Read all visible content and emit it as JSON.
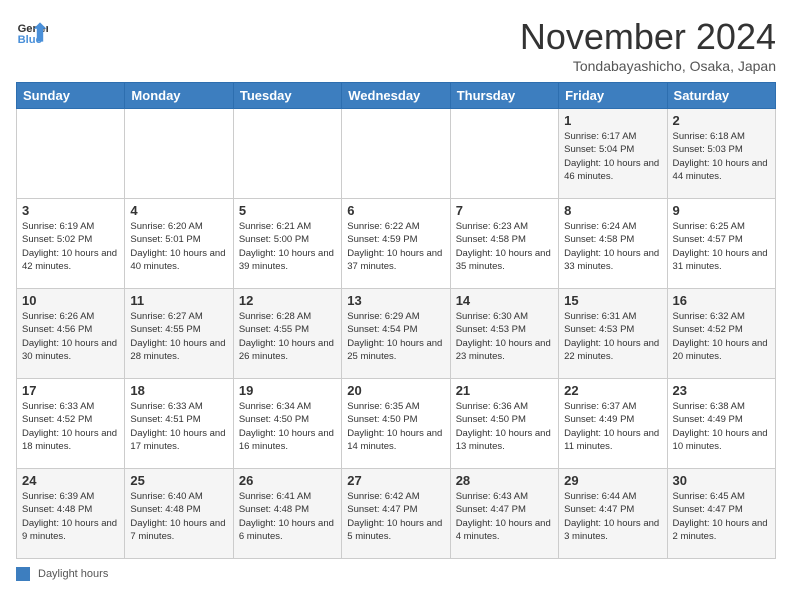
{
  "header": {
    "logo_line1": "General",
    "logo_line2": "Blue",
    "month": "November 2024",
    "location": "Tondabayashicho, Osaka, Japan"
  },
  "weekdays": [
    "Sunday",
    "Monday",
    "Tuesday",
    "Wednesday",
    "Thursday",
    "Friday",
    "Saturday"
  ],
  "legend": {
    "label": "Daylight hours"
  },
  "weeks": [
    [
      {
        "day": "",
        "info": ""
      },
      {
        "day": "",
        "info": ""
      },
      {
        "day": "",
        "info": ""
      },
      {
        "day": "",
        "info": ""
      },
      {
        "day": "",
        "info": ""
      },
      {
        "day": "1",
        "info": "Sunrise: 6:17 AM\nSunset: 5:04 PM\nDaylight: 10 hours and 46 minutes."
      },
      {
        "day": "2",
        "info": "Sunrise: 6:18 AM\nSunset: 5:03 PM\nDaylight: 10 hours and 44 minutes."
      }
    ],
    [
      {
        "day": "3",
        "info": "Sunrise: 6:19 AM\nSunset: 5:02 PM\nDaylight: 10 hours and 42 minutes."
      },
      {
        "day": "4",
        "info": "Sunrise: 6:20 AM\nSunset: 5:01 PM\nDaylight: 10 hours and 40 minutes."
      },
      {
        "day": "5",
        "info": "Sunrise: 6:21 AM\nSunset: 5:00 PM\nDaylight: 10 hours and 39 minutes."
      },
      {
        "day": "6",
        "info": "Sunrise: 6:22 AM\nSunset: 4:59 PM\nDaylight: 10 hours and 37 minutes."
      },
      {
        "day": "7",
        "info": "Sunrise: 6:23 AM\nSunset: 4:58 PM\nDaylight: 10 hours and 35 minutes."
      },
      {
        "day": "8",
        "info": "Sunrise: 6:24 AM\nSunset: 4:58 PM\nDaylight: 10 hours and 33 minutes."
      },
      {
        "day": "9",
        "info": "Sunrise: 6:25 AM\nSunset: 4:57 PM\nDaylight: 10 hours and 31 minutes."
      }
    ],
    [
      {
        "day": "10",
        "info": "Sunrise: 6:26 AM\nSunset: 4:56 PM\nDaylight: 10 hours and 30 minutes."
      },
      {
        "day": "11",
        "info": "Sunrise: 6:27 AM\nSunset: 4:55 PM\nDaylight: 10 hours and 28 minutes."
      },
      {
        "day": "12",
        "info": "Sunrise: 6:28 AM\nSunset: 4:55 PM\nDaylight: 10 hours and 26 minutes."
      },
      {
        "day": "13",
        "info": "Sunrise: 6:29 AM\nSunset: 4:54 PM\nDaylight: 10 hours and 25 minutes."
      },
      {
        "day": "14",
        "info": "Sunrise: 6:30 AM\nSunset: 4:53 PM\nDaylight: 10 hours and 23 minutes."
      },
      {
        "day": "15",
        "info": "Sunrise: 6:31 AM\nSunset: 4:53 PM\nDaylight: 10 hours and 22 minutes."
      },
      {
        "day": "16",
        "info": "Sunrise: 6:32 AM\nSunset: 4:52 PM\nDaylight: 10 hours and 20 minutes."
      }
    ],
    [
      {
        "day": "17",
        "info": "Sunrise: 6:33 AM\nSunset: 4:52 PM\nDaylight: 10 hours and 18 minutes."
      },
      {
        "day": "18",
        "info": "Sunrise: 6:33 AM\nSunset: 4:51 PM\nDaylight: 10 hours and 17 minutes."
      },
      {
        "day": "19",
        "info": "Sunrise: 6:34 AM\nSunset: 4:50 PM\nDaylight: 10 hours and 16 minutes."
      },
      {
        "day": "20",
        "info": "Sunrise: 6:35 AM\nSunset: 4:50 PM\nDaylight: 10 hours and 14 minutes."
      },
      {
        "day": "21",
        "info": "Sunrise: 6:36 AM\nSunset: 4:50 PM\nDaylight: 10 hours and 13 minutes."
      },
      {
        "day": "22",
        "info": "Sunrise: 6:37 AM\nSunset: 4:49 PM\nDaylight: 10 hours and 11 minutes."
      },
      {
        "day": "23",
        "info": "Sunrise: 6:38 AM\nSunset: 4:49 PM\nDaylight: 10 hours and 10 minutes."
      }
    ],
    [
      {
        "day": "24",
        "info": "Sunrise: 6:39 AM\nSunset: 4:48 PM\nDaylight: 10 hours and 9 minutes."
      },
      {
        "day": "25",
        "info": "Sunrise: 6:40 AM\nSunset: 4:48 PM\nDaylight: 10 hours and 7 minutes."
      },
      {
        "day": "26",
        "info": "Sunrise: 6:41 AM\nSunset: 4:48 PM\nDaylight: 10 hours and 6 minutes."
      },
      {
        "day": "27",
        "info": "Sunrise: 6:42 AM\nSunset: 4:47 PM\nDaylight: 10 hours and 5 minutes."
      },
      {
        "day": "28",
        "info": "Sunrise: 6:43 AM\nSunset: 4:47 PM\nDaylight: 10 hours and 4 minutes."
      },
      {
        "day": "29",
        "info": "Sunrise: 6:44 AM\nSunset: 4:47 PM\nDaylight: 10 hours and 3 minutes."
      },
      {
        "day": "30",
        "info": "Sunrise: 6:45 AM\nSunset: 4:47 PM\nDaylight: 10 hours and 2 minutes."
      }
    ]
  ]
}
